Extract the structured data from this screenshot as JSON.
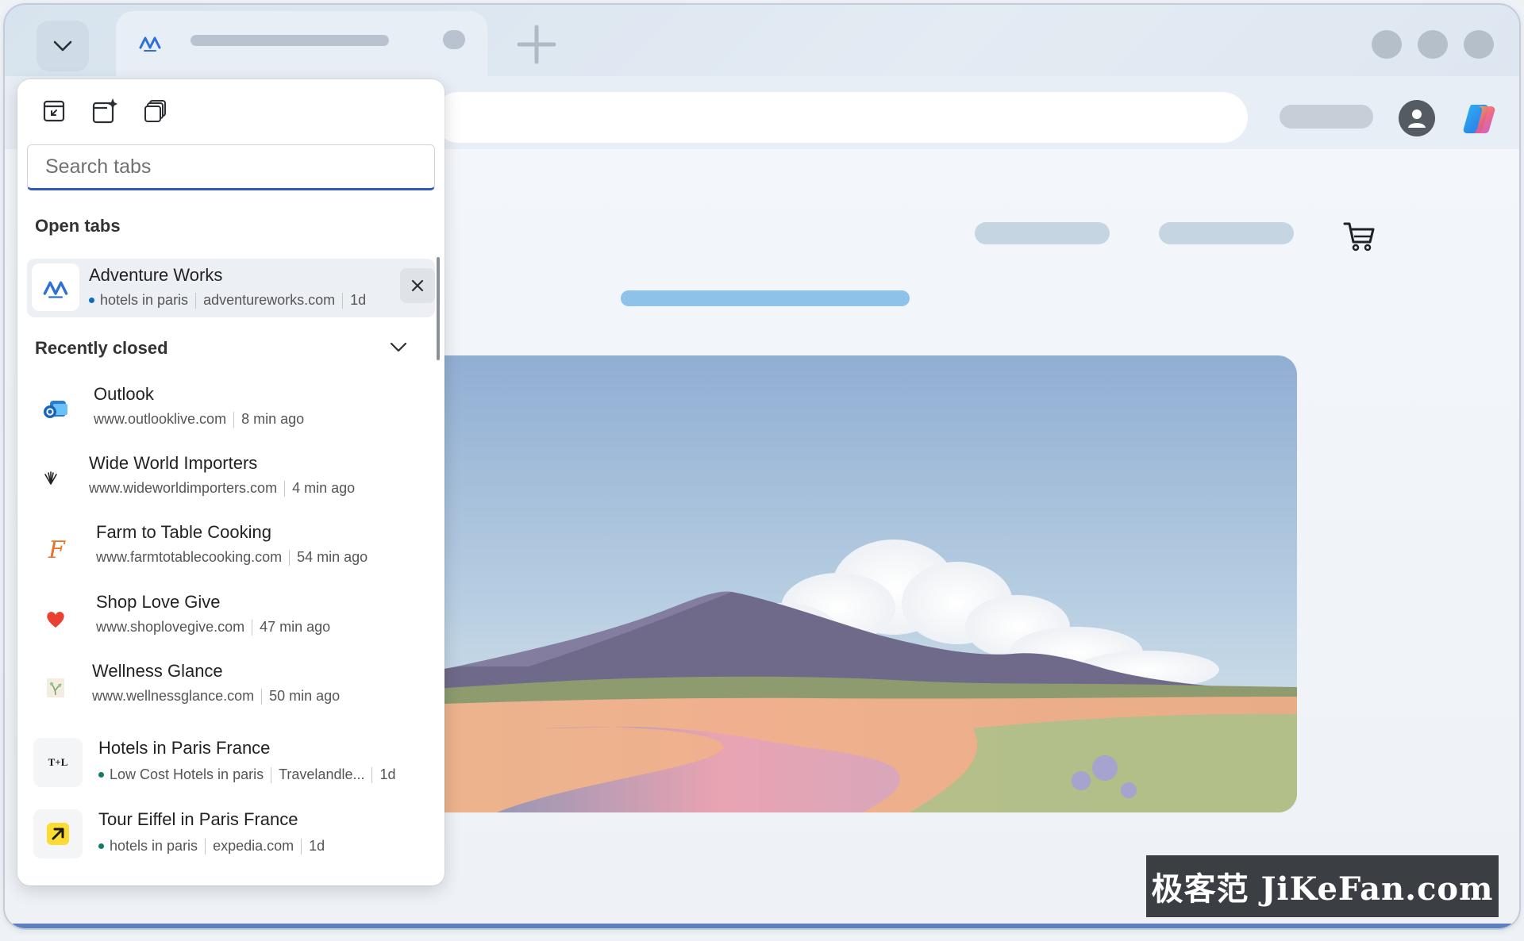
{
  "popup": {
    "search": {
      "placeholder": "Search tabs"
    },
    "open_tabs_title": "Open tabs",
    "open_tab": {
      "title": "Adventure Works",
      "group": "hotels in paris",
      "domain": "adventureworks.com",
      "age": "1d"
    },
    "recently_closed_title": "Recently closed",
    "recently_closed": [
      {
        "title": "Outlook",
        "url": "www.outlooklive.com",
        "age": "8 min ago",
        "icon": "outlook-icon"
      },
      {
        "title": "Wide World Importers",
        "url": "www.wideworldimporters.com",
        "age": "4 min ago",
        "icon": "wide-world-importers-icon"
      },
      {
        "title": "Farm to Table Cooking",
        "url": "www.farmtotablecooking.com",
        "age": "54 min ago",
        "icon": "farm-to-table-icon"
      },
      {
        "title": "Shop Love Give",
        "url": "www.shoplovegive.com",
        "age": "47 min ago",
        "icon": "heart-icon"
      },
      {
        "title": "Wellness Glance",
        "url": "www.wellnessglance.com",
        "age": "50 min ago",
        "icon": "wellness-glance-icon"
      },
      {
        "title": "Hotels in Paris France",
        "group": "Low Cost Hotels in paris",
        "url": "Travelandle...",
        "age": "1d",
        "icon": "travel-leisure-icon",
        "favicon_text": "T+L"
      },
      {
        "title": "Tour Eiffel in Paris France",
        "group": "hotels in paris",
        "url": "expedia.com",
        "age": "1d",
        "icon": "expedia-icon"
      }
    ]
  },
  "watermark": "极客范 JiKeFan.com",
  "colors": {
    "accent": "#2c5bbd",
    "tab_group_dot_blue": "#0f6cbd",
    "tab_group_dot_teal": "#107c6c",
    "hero_bar": "#8ec2e8"
  }
}
